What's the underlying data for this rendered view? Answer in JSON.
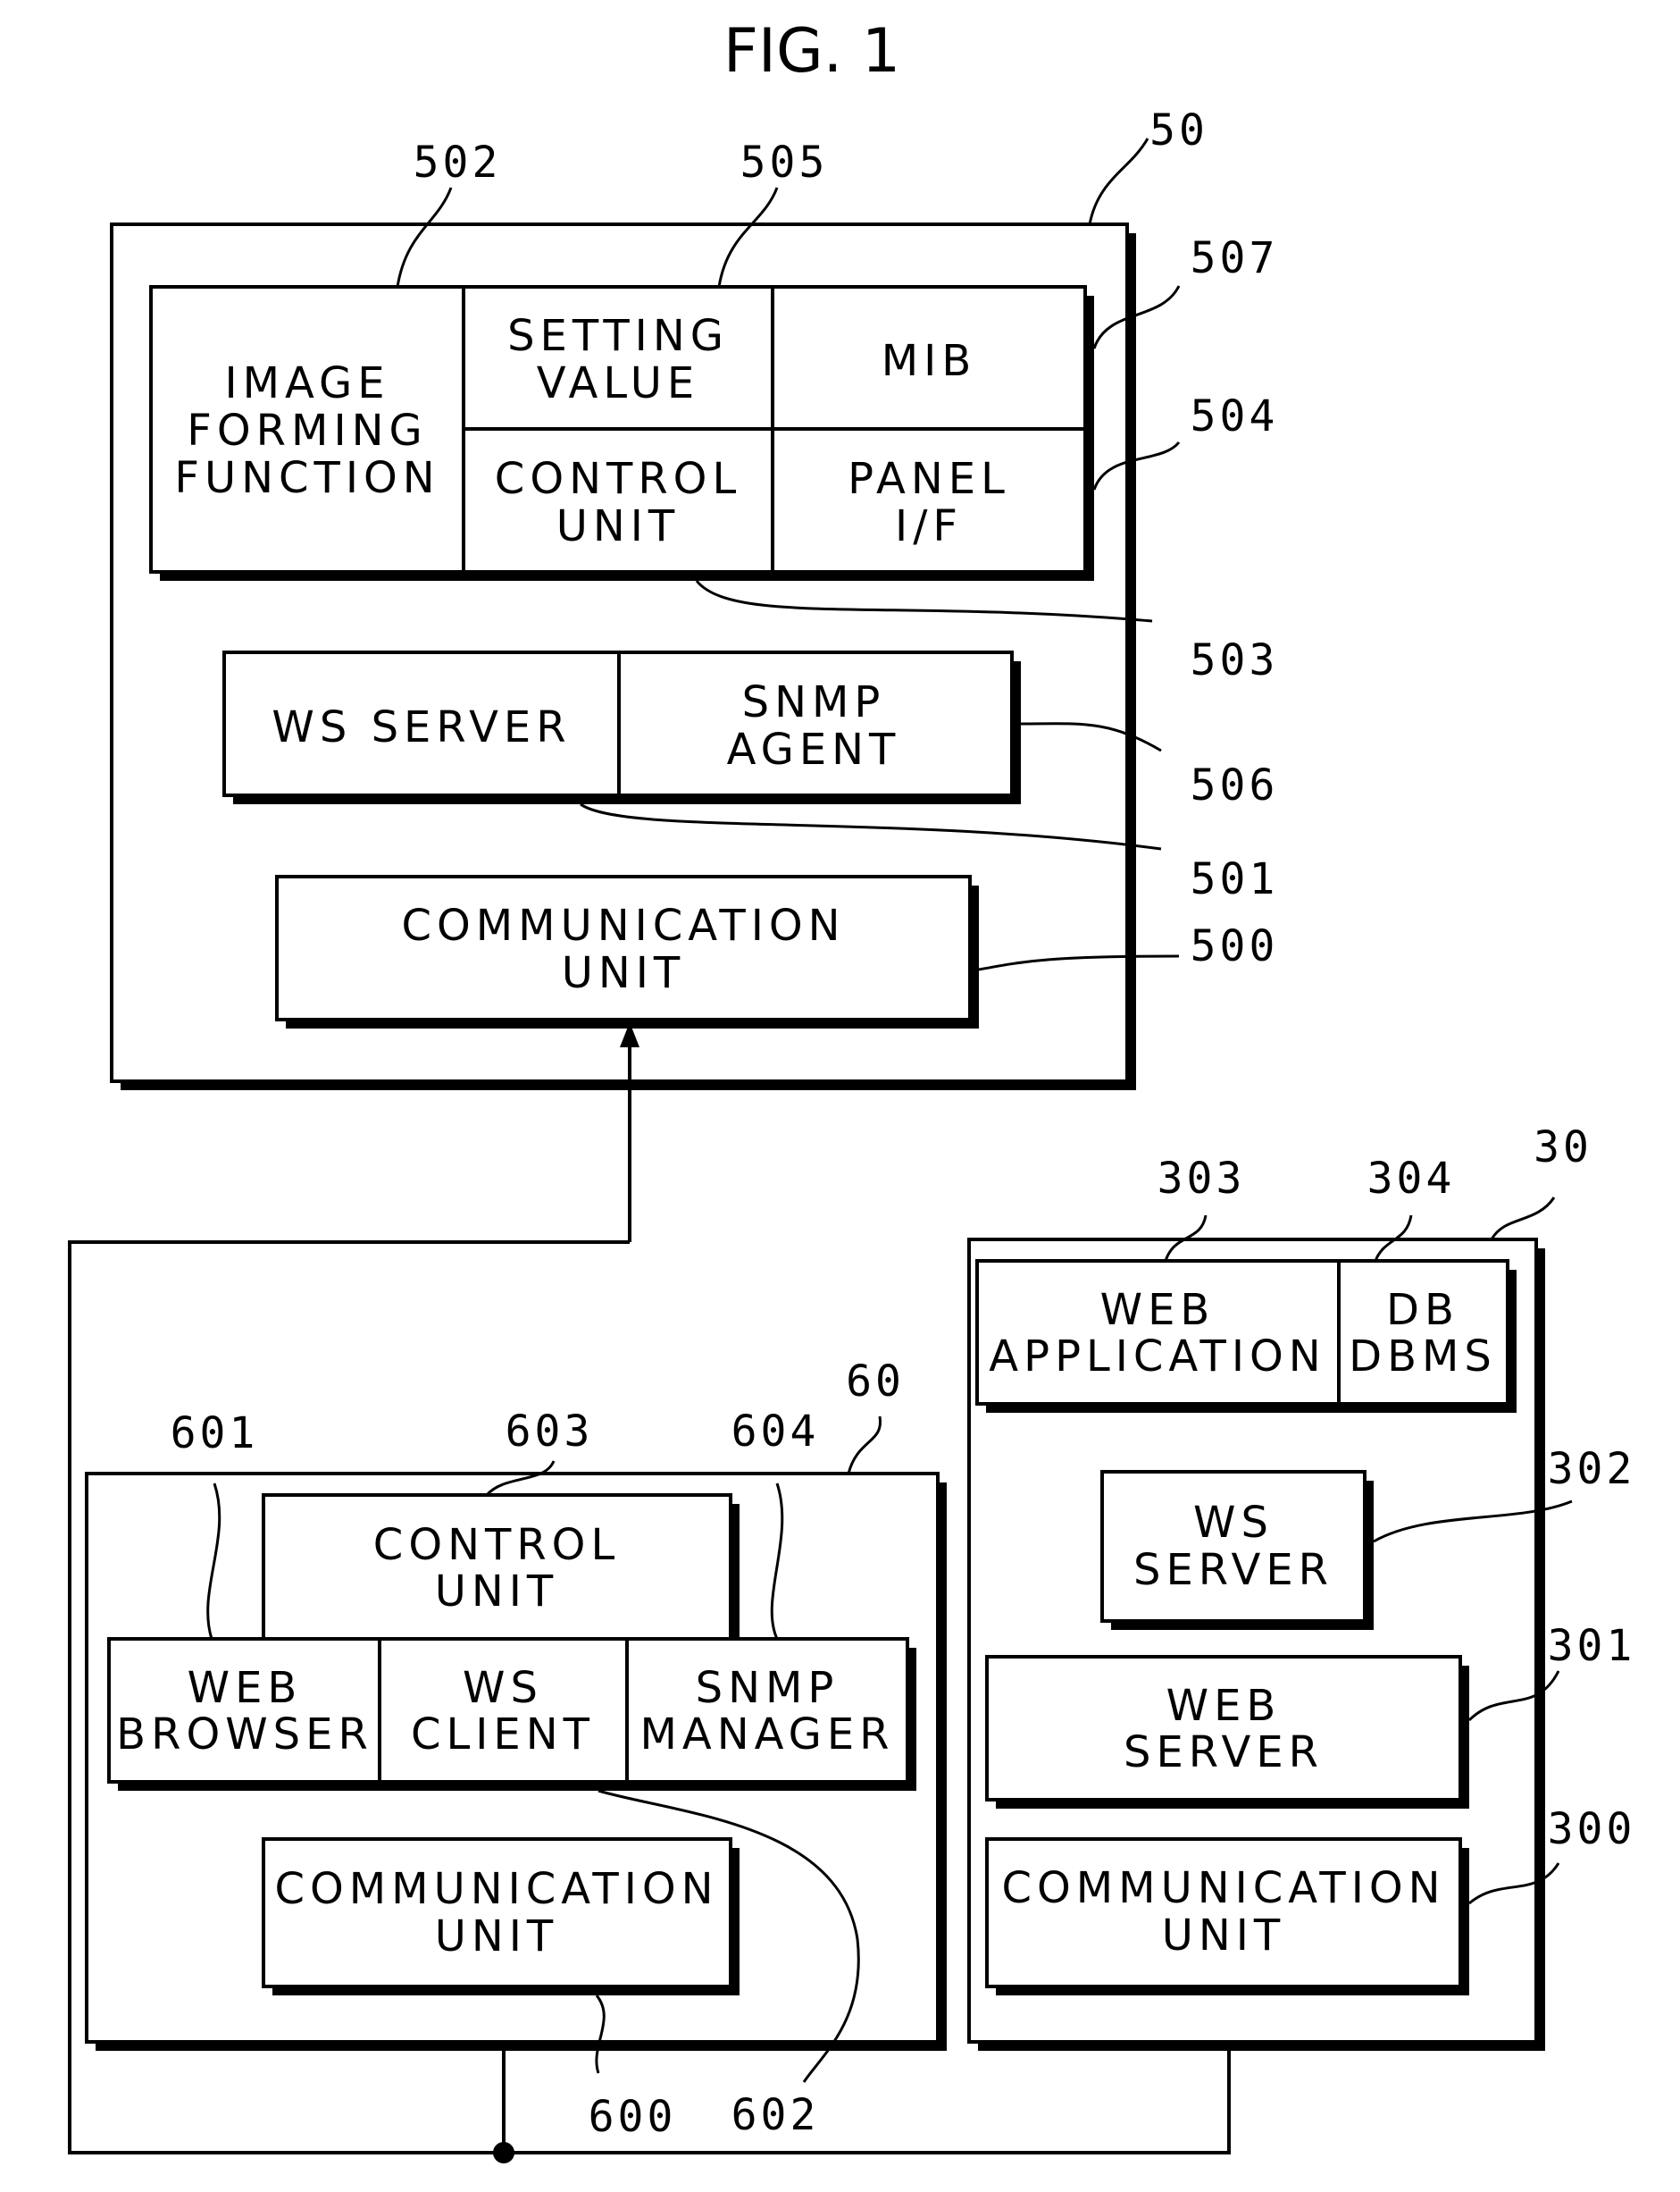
{
  "figure": {
    "title": "FIG. 1"
  },
  "device_50": {
    "ref": "50",
    "image_forming_function": {
      "ref": "502",
      "lines": [
        "IMAGE",
        "FORMING",
        "FUNCTION"
      ]
    },
    "setting_value": {
      "ref": "505",
      "lines": [
        "SETTING",
        "VALUE"
      ]
    },
    "mib": {
      "ref": "507",
      "lines": [
        "MIB"
      ]
    },
    "control_unit": {
      "ref": "503",
      "lines": [
        "CONTROL",
        "UNIT"
      ]
    },
    "panel_if": {
      "ref": "504",
      "lines": [
        "PANEL",
        "I/F"
      ]
    },
    "ws_server": {
      "ref": "501",
      "lines": [
        "WS SERVER"
      ]
    },
    "snmp_agent": {
      "ref": "506",
      "lines": [
        "SNMP",
        "AGENT"
      ]
    },
    "communication_unit": {
      "ref": "500",
      "lines": [
        "COMMUNICATION",
        "UNIT"
      ]
    }
  },
  "client_60": {
    "ref": "60",
    "control_unit": {
      "ref": "603",
      "lines": [
        "CONTROL",
        "UNIT"
      ]
    },
    "web_browser": {
      "ref": "601",
      "lines": [
        "WEB",
        "BROWSER"
      ]
    },
    "ws_client": {
      "ref": "602",
      "lines": [
        "WS",
        "CLIENT"
      ]
    },
    "snmp_manager": {
      "ref": "604",
      "lines": [
        "SNMP",
        "MANAGER"
      ]
    },
    "communication_unit": {
      "ref": "600",
      "lines": [
        "COMMUNICATION",
        "UNIT"
      ]
    }
  },
  "server_30": {
    "ref": "30",
    "web_application": {
      "ref": "303",
      "lines": [
        "WEB",
        "APPLICATION"
      ]
    },
    "db_dbms": {
      "ref": "304",
      "lines": [
        "DB",
        "DBMS"
      ]
    },
    "ws_server": {
      "ref": "302",
      "lines": [
        "WS",
        "SERVER"
      ]
    },
    "web_server": {
      "ref": "301",
      "lines": [
        "WEB",
        "SERVER"
      ]
    },
    "communication_unit": {
      "ref": "300",
      "lines": [
        "COMMUNICATION",
        "UNIT"
      ]
    }
  }
}
